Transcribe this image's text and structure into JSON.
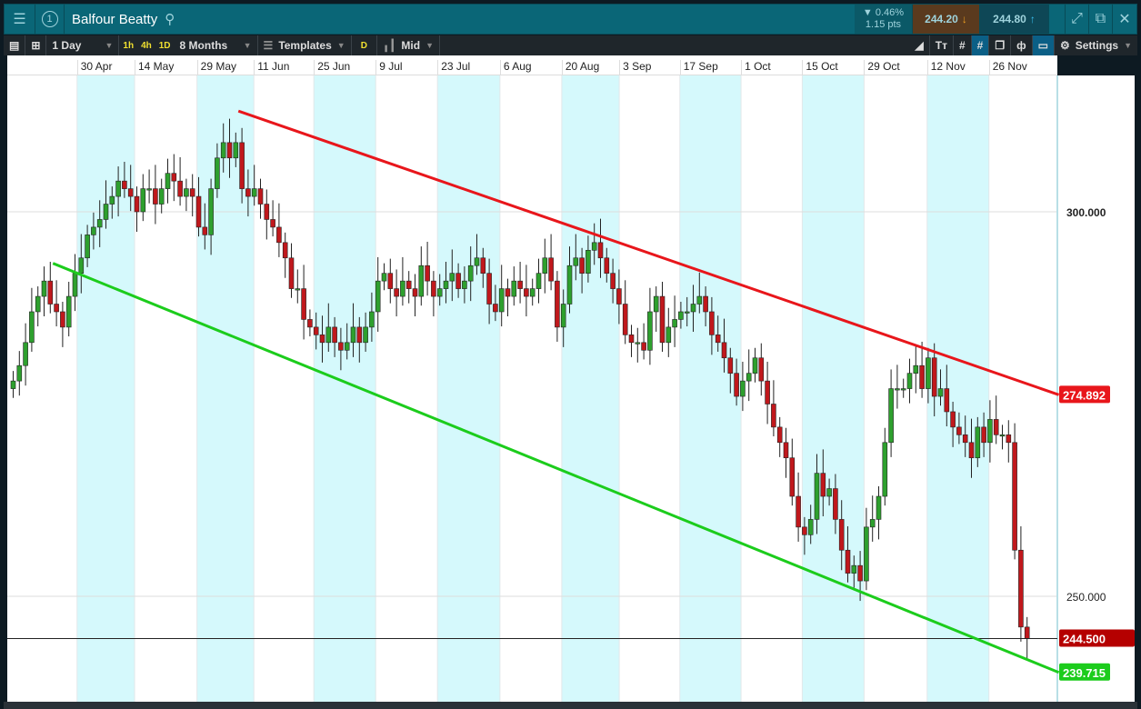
{
  "header": {
    "menu_icon": "hamburger-icon",
    "badge": "1",
    "title": "Balfour Beatty",
    "change_pct": "▼ 0.46%",
    "change_pts": "1.15 pts",
    "sell": "244.20",
    "buy": "244.80"
  },
  "toolbar": {
    "interval": "1 Day",
    "quick": [
      "1h",
      "4h",
      "1D"
    ],
    "range": "8 Months",
    "templates": "Templates",
    "d": "D",
    "price_type": "Mid",
    "settings": "Settings"
  },
  "colors": {
    "up": "#2ea02e",
    "down": "#c0181c",
    "band": "#d5f9fc",
    "red_line": "#e8161b",
    "green_line": "#1ccc1c",
    "last": "#b50000"
  },
  "chart_data": {
    "type": "candlestick",
    "title": "Balfour Beatty",
    "ylim": [
      239,
      318
    ],
    "y_ticks": [
      {
        "value": 300,
        "label": "300.000"
      },
      {
        "value": 250,
        "label": "250.000"
      }
    ],
    "x_ticks": [
      {
        "i": 10.7,
        "label": "30 Apr"
      },
      {
        "i": 20,
        "label": "14 May"
      },
      {
        "i": 30.1,
        "label": "29 May"
      },
      {
        "i": 39.3,
        "label": "11 Jun"
      },
      {
        "i": 49,
        "label": "25 Jun"
      },
      {
        "i": 59,
        "label": "9 Jul"
      },
      {
        "i": 69,
        "label": "23 Jul"
      },
      {
        "i": 79.1,
        "label": "6 Aug"
      },
      {
        "i": 89.1,
        "label": "20 Aug"
      },
      {
        "i": 98.4,
        "label": "3 Sep"
      },
      {
        "i": 108.2,
        "label": "17 Sep"
      },
      {
        "i": 118.1,
        "label": "1 Oct"
      },
      {
        "i": 128,
        "label": "15 Oct"
      },
      {
        "i": 138,
        "label": "29 Oct"
      },
      {
        "i": 148.2,
        "label": "12 Nov"
      },
      {
        "i": 158.2,
        "label": "26 Nov"
      }
    ],
    "first_open": 277,
    "closes": [
      278,
      280,
      283,
      287,
      289,
      291,
      288,
      287,
      285,
      289,
      292,
      294,
      297,
      298,
      299,
      301,
      302,
      304,
      303,
      302,
      300,
      303,
      303,
      301,
      303,
      305,
      304,
      302,
      303,
      302,
      298,
      297,
      303,
      307,
      309,
      307,
      309,
      303,
      302,
      303,
      301,
      299,
      298,
      296,
      294,
      290,
      290,
      286,
      285,
      284,
      283,
      285,
      283,
      282,
      283,
      285,
      283,
      285,
      287,
      291,
      292,
      290,
      289,
      291,
      290,
      289,
      293,
      291,
      289,
      290,
      291,
      292,
      290,
      291,
      293,
      294,
      292,
      288,
      287,
      290,
      289,
      291,
      290,
      289,
      290,
      292,
      294,
      291,
      285,
      288,
      293,
      294,
      292,
      295,
      296,
      294,
      292,
      290,
      288,
      284,
      283,
      283,
      282,
      287,
      289,
      283,
      285,
      286,
      287,
      287,
      288,
      289,
      287,
      284,
      283,
      281,
      279,
      276,
      278,
      279,
      281,
      278,
      275,
      272,
      270,
      268,
      263,
      259,
      258,
      260,
      266,
      263,
      264,
      260,
      256,
      253,
      254,
      252,
      259,
      260,
      263,
      270,
      277,
      277,
      277,
      279,
      280,
      277,
      281,
      276,
      277,
      274,
      272,
      271,
      270,
      268,
      272,
      270,
      273,
      271,
      271,
      270,
      256,
      246,
      244.5
    ],
    "trendlines": [
      {
        "name": "resistance",
        "from": [
          36.8,
          313.1
        ],
        "to": [
          169.5,
          276.2
        ],
        "label": "274.892"
      },
      {
        "name": "support",
        "from": [
          6.8,
          293.3
        ],
        "to": [
          169.5,
          240.1
        ],
        "label": "239.715"
      }
    ],
    "last_price": {
      "value": 244.5,
      "label": "244.500"
    }
  }
}
